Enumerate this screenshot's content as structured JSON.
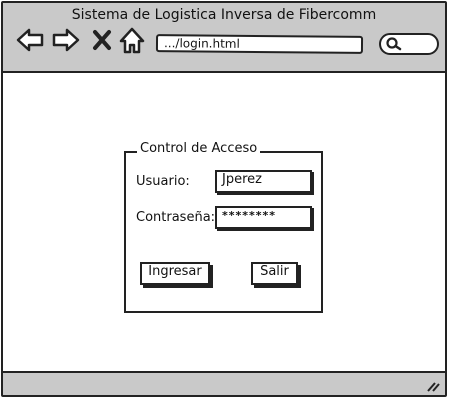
{
  "window": {
    "title": "Sistema de Logistica Inversa de Fibercomm"
  },
  "toolbar": {
    "icons": [
      "back-icon",
      "forward-icon",
      "close-icon",
      "home-icon"
    ],
    "address": ".../login.html",
    "search_icon": "search-icon"
  },
  "login": {
    "legend": "Control de Acceso",
    "user_label": "Usuario:",
    "user_value": "Jperez",
    "password_label": "Contraseña:",
    "password_value": "********",
    "submit_label": "Ingresar",
    "exit_label": "Salir"
  },
  "colors": {
    "chrome": "#c9c9c9",
    "stroke": "#222222",
    "background": "#ffffff"
  }
}
